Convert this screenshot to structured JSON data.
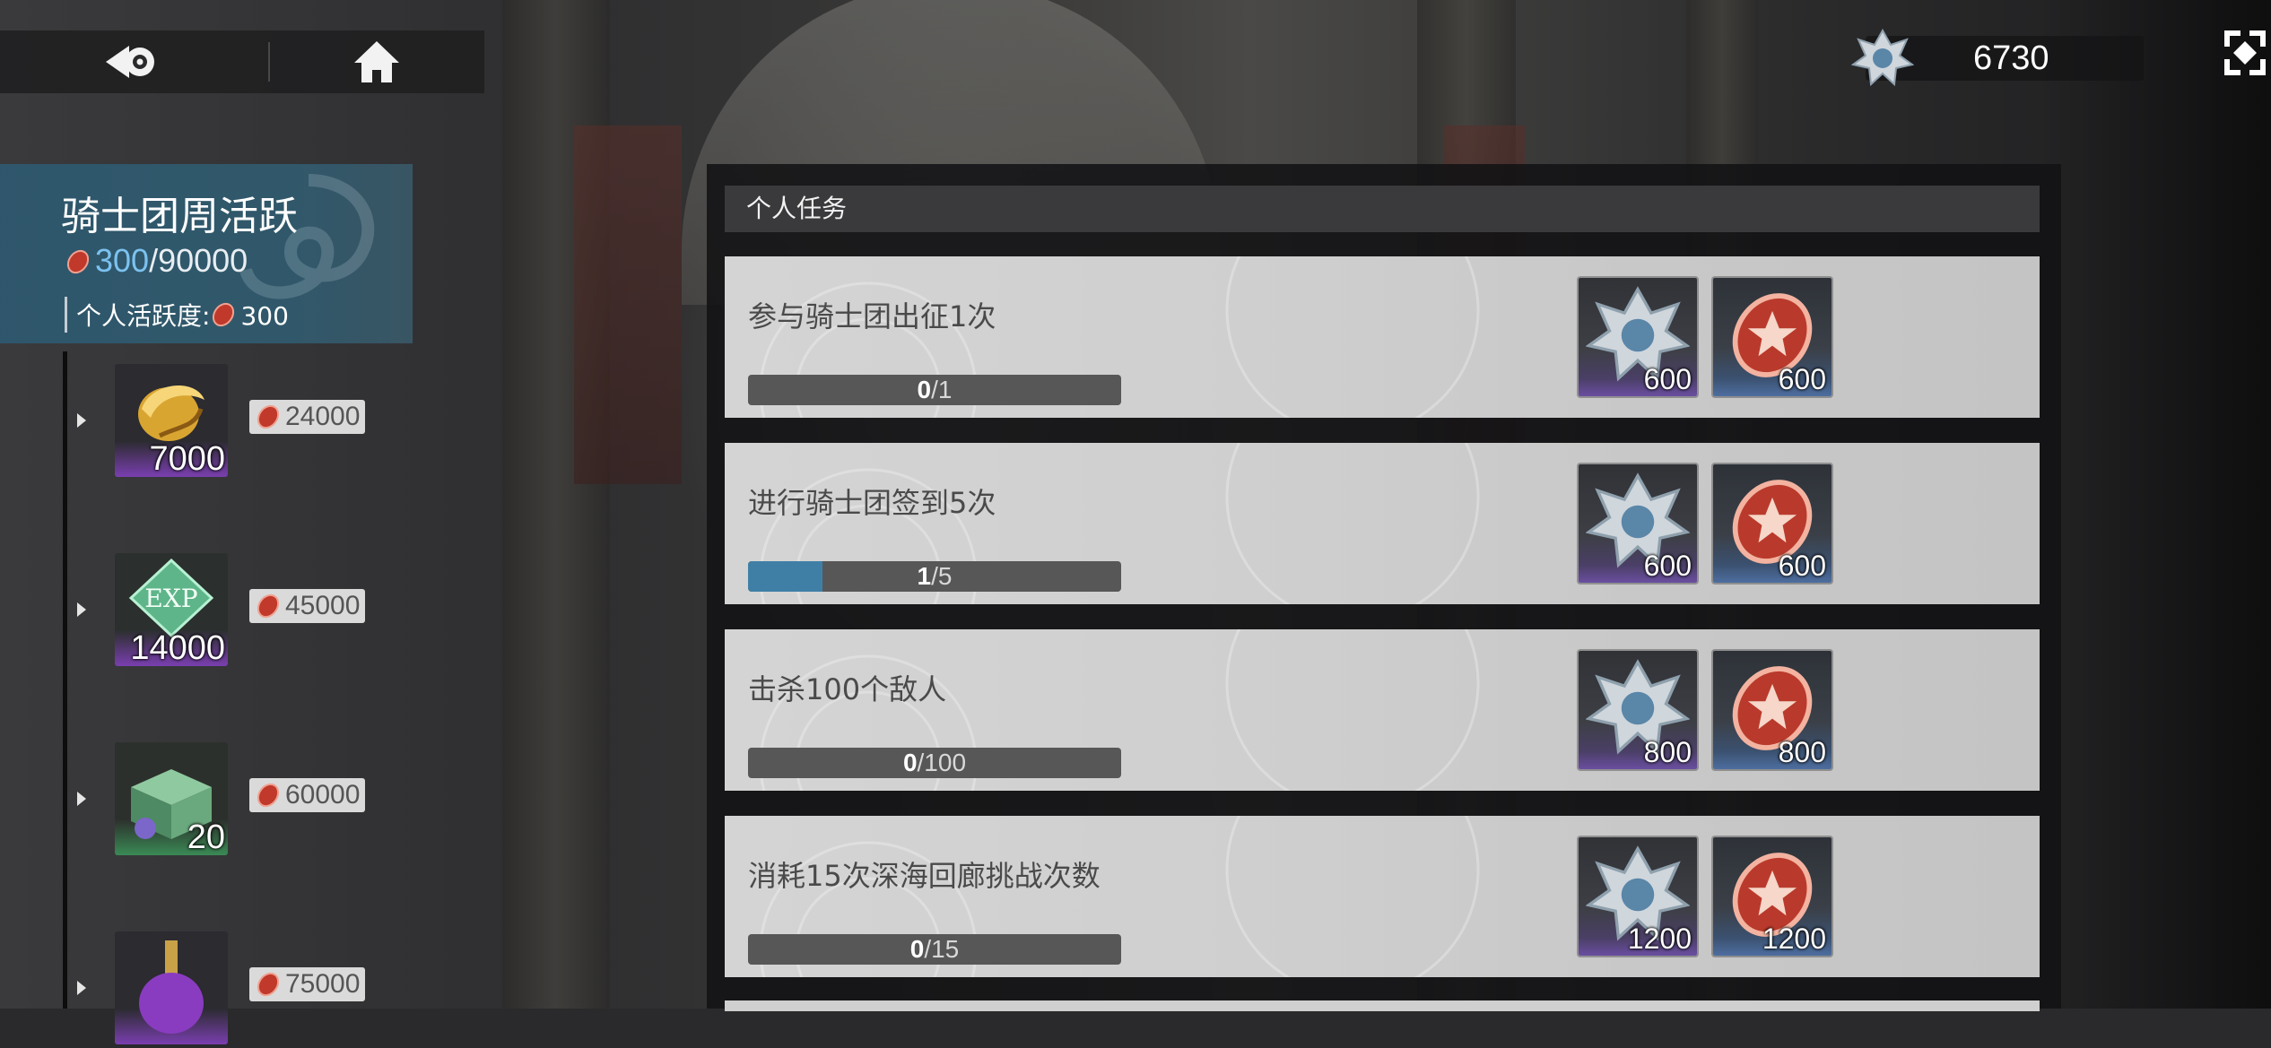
{
  "nav": {
    "back_icon": "back-arrow-icon",
    "home_icon": "home-icon"
  },
  "currency": {
    "icon": "silver-crest-icon",
    "value": "6730"
  },
  "summary": {
    "title": "骑士团周活跃",
    "progress_current": "300",
    "progress_total": "/90000",
    "personal_label": "个人活跃度:",
    "personal_value": "300"
  },
  "milestones": [
    {
      "item": "gold-crest-icon",
      "count": "7000",
      "required": "24000",
      "quality_color": "#7a3fb0"
    },
    {
      "item": "exp-crystal-icon",
      "count": "14000",
      "required": "45000",
      "quality_color": "#7a3fb0"
    },
    {
      "item": "chest-icon",
      "count": "20",
      "required": "60000",
      "quality_color": "#3a8a55"
    },
    {
      "item": "potion-icon",
      "count": "",
      "required": "75000",
      "quality_color": "#7a3fb0"
    }
  ],
  "panel": {
    "header": "个人任务"
  },
  "tasks": [
    {
      "desc": "参与骑士团出征1次",
      "cur": "0",
      "total": "/1",
      "progress": 0,
      "reward1": "600",
      "reward2": "600"
    },
    {
      "desc": "进行骑士团签到5次",
      "cur": "1",
      "total": "/5",
      "progress": 0.2,
      "reward1": "600",
      "reward2": "600"
    },
    {
      "desc": "击杀100个敌人",
      "cur": "0",
      "total": "/100",
      "progress": 0,
      "reward1": "800",
      "reward2": "800"
    },
    {
      "desc": "消耗15次深海回廊挑战次数",
      "cur": "0",
      "total": "/15",
      "progress": 0,
      "reward1": "1200",
      "reward2": "1200"
    }
  ],
  "colors": {
    "accent": "#3f7fa6",
    "summary_bg": "#2e586e",
    "progress_highlight": "#7cc2f0"
  }
}
